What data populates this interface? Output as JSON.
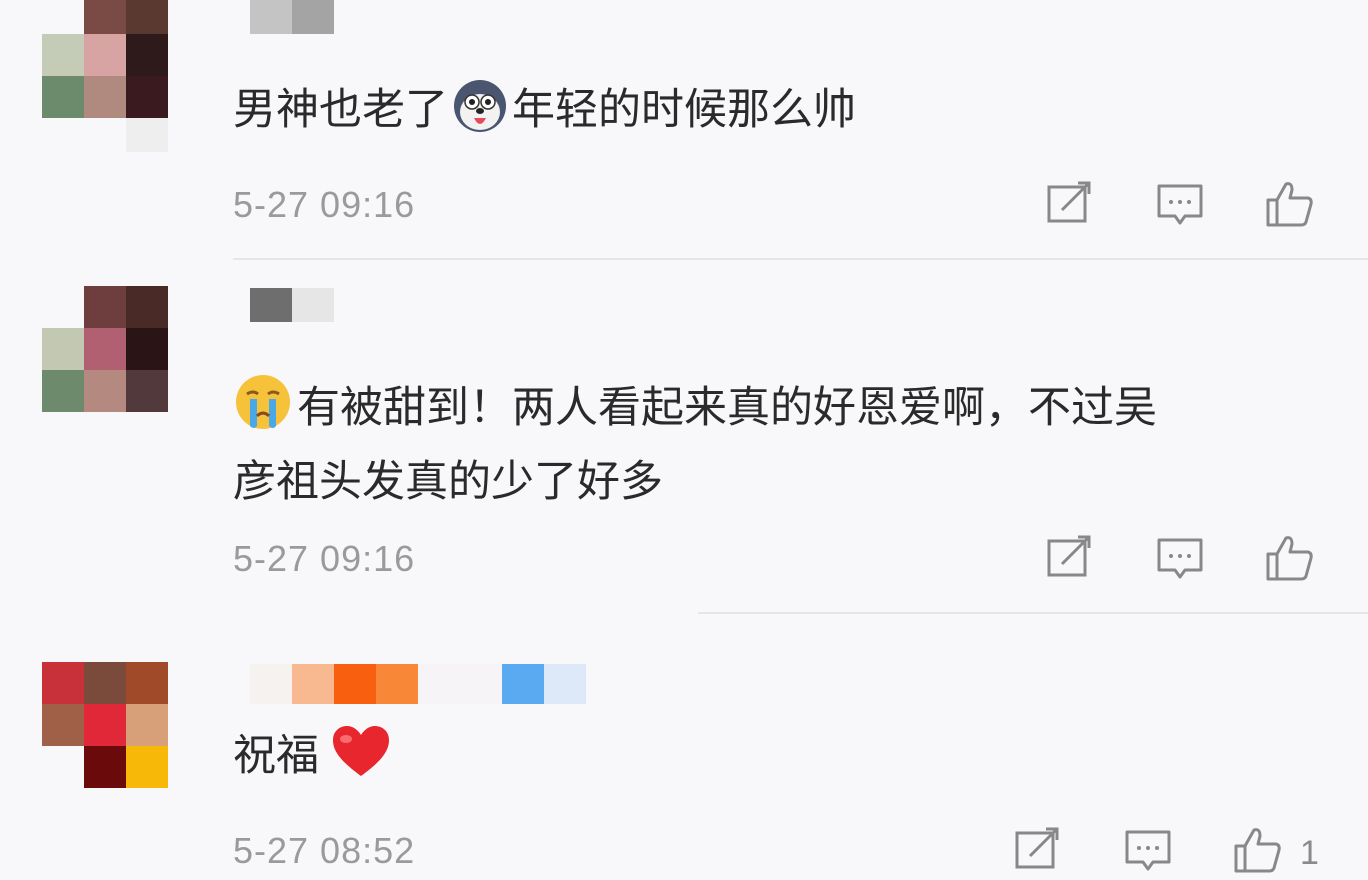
{
  "comments": [
    {
      "text_a": "男神也老了",
      "text_b": "年轻的时候那么帅",
      "emoji_icon": "husky-emoji-icon",
      "time": "5-27 09:16",
      "likes": ""
    },
    {
      "line1": "有被甜到！两人看起来真的好恩爱啊，不过吴",
      "line2": "彦祖头发真的少了好多",
      "emoji_icon": "crying-face-icon",
      "time": "5-27 09:16",
      "likes": ""
    },
    {
      "text": "祝福",
      "emoji_icon": "red-heart-icon",
      "time": "5-27 08:52",
      "likes": "1"
    }
  ],
  "actions": {
    "share_icon": "share-icon",
    "reply_icon": "comment-icon",
    "like_icon": "thumbs-up-icon"
  },
  "colors": {
    "background": "#f8f7fa",
    "text": "#2a2a2a",
    "meta": "#9a9a9a",
    "heart": "#e8262e"
  }
}
